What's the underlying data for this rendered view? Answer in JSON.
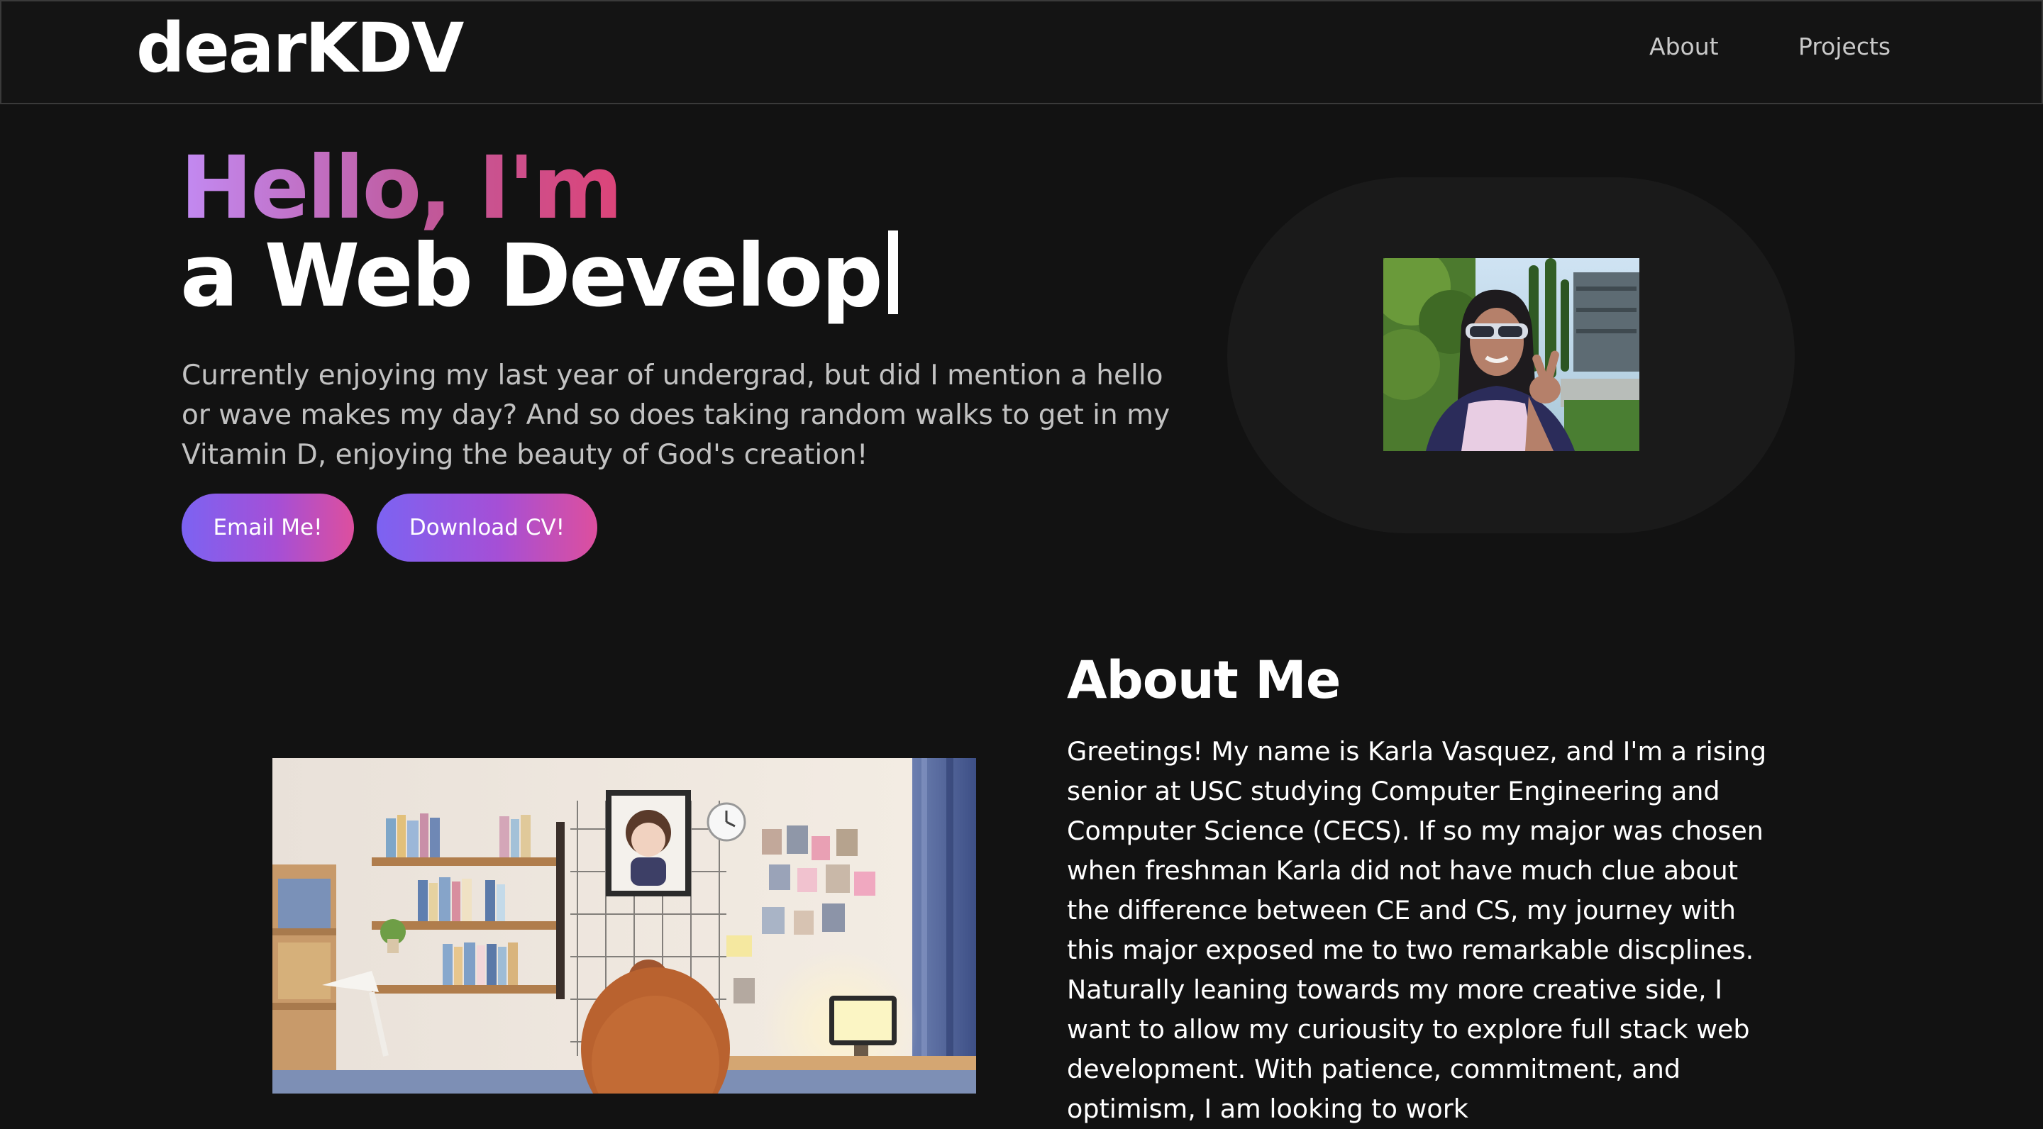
{
  "navbar": {
    "logo": "dearKDV",
    "links": [
      {
        "label": "About"
      },
      {
        "label": "Projects"
      }
    ]
  },
  "hero": {
    "greeting": "Hello, I'm",
    "role_typed": "a Web Develop",
    "description": "Currently enjoying my last year of undergrad, but did I mention a hello or wave makes my day? And so does taking random walks to get in my Vitamin D, enjoying the beauty of God's creation!",
    "buttons": {
      "email": "Email Me!",
      "cv": "Download CV!"
    }
  },
  "about": {
    "title": "About Me",
    "body": "Greetings! My name is Karla Vasquez, and I'm a rising senior at USC studying Computer Engineering and Computer Science (CECS). If so my major was chosen when freshman Karla did not have much clue about the difference between CE and CS, my journey with this major exposed me to two remarkable discplines. Naturally leaning towards my more creative side, I want to allow my curiousity to explore full stack web development. With patience, commitment, and optimism, I am looking to work"
  },
  "colors": {
    "background": "#121212",
    "gradient_start": "#7c63f2",
    "gradient_end": "#dd4f9e",
    "greeting_gradient": [
      "#c28af3",
      "#dc4479"
    ]
  }
}
